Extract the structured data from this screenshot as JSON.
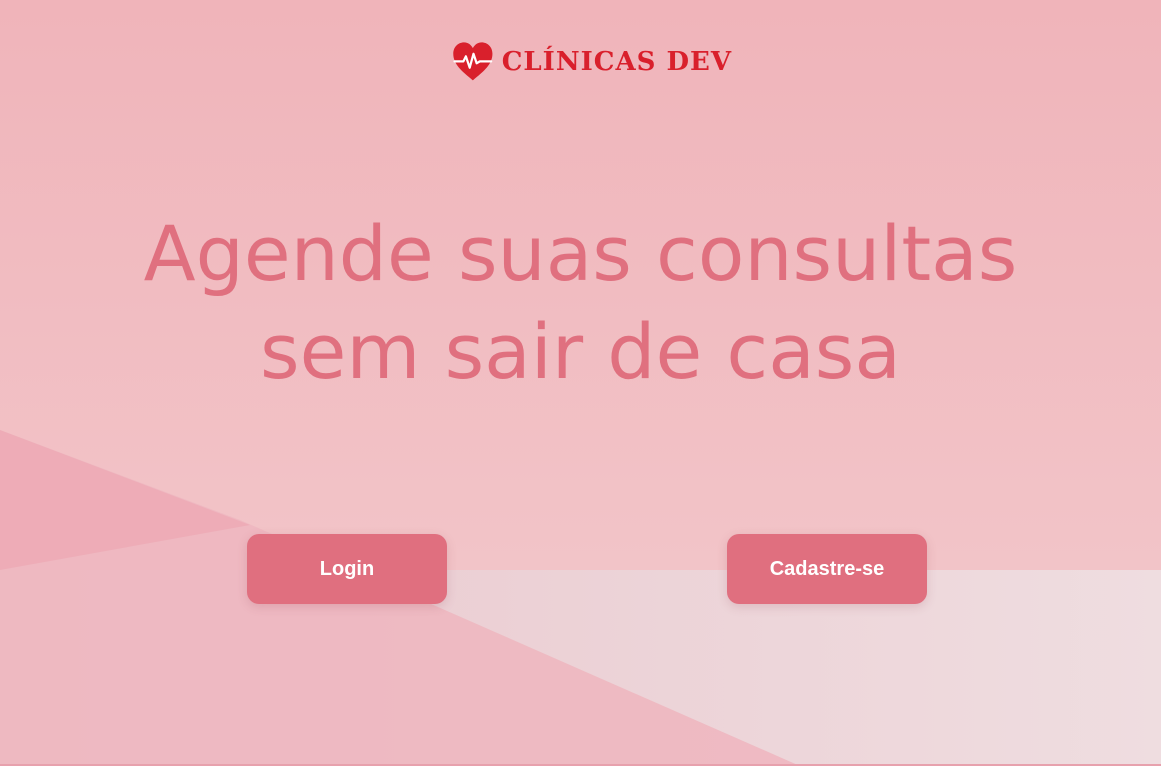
{
  "brand": {
    "name": "CLÍNICAS DEV",
    "logo_icon": "heart-pulse-icon",
    "color": "#d9202c"
  },
  "hero": {
    "line1": "Agende suas consultas",
    "line2": "sem sair de casa",
    "color": "#e0707f"
  },
  "actions": {
    "login_label": "Login",
    "signup_label": "Cadastre-se",
    "button_color": "#e06f7f"
  },
  "background": {
    "primary": "#efb7bd",
    "secondary": "#edd8dc"
  }
}
